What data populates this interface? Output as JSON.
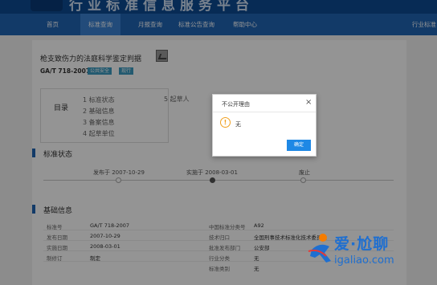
{
  "header": {
    "site_title": "行业标准信息服务平台"
  },
  "nav": {
    "items": [
      {
        "label": "首页"
      },
      {
        "label": "标准查询"
      },
      {
        "label": "月报查询"
      },
      {
        "label": "标准公告查询"
      },
      {
        "label": "帮助中心"
      },
      {
        "label": "行业标准"
      }
    ]
  },
  "document": {
    "title": "枪支致伤力的法庭科学鉴定判据",
    "code": "GA/T 718-2007",
    "tags": [
      "公共安全",
      "现行"
    ]
  },
  "toc": {
    "label": "目录",
    "items": [
      "1 标准状态",
      "2 基础信息",
      "3 备案信息",
      "4 起草单位",
      "5 起草人"
    ]
  },
  "status_section": {
    "title": "标准状态",
    "timeline": [
      {
        "label": "发布于 2007-10-29"
      },
      {
        "label": "实施于 2008-03-01"
      },
      {
        "label": "废止"
      }
    ]
  },
  "basic_info": {
    "title": "基础信息",
    "left": [
      {
        "label": "标准号",
        "value": "GA/T 718-2007"
      },
      {
        "label": "发布日期",
        "value": "2007-10-29"
      },
      {
        "label": "实施日期",
        "value": "2008-03-01"
      },
      {
        "label": "制修订",
        "value": "制定"
      }
    ],
    "right": [
      {
        "label": "中国标准分类号",
        "value": "A92"
      },
      {
        "label": "技术归口",
        "value": "全国刑事技术标准化技术委员会"
      },
      {
        "label": "批准发布部门",
        "value": "公安部"
      },
      {
        "label": "行业分类",
        "value": "无"
      },
      {
        "label": "标准类别",
        "value": "无"
      }
    ]
  },
  "modal": {
    "title": "不公开理由",
    "close_glyph": "×",
    "message": "无",
    "ok_label": "确定"
  },
  "watermark": {
    "text": "爱·尬聊",
    "url": "igaliao.com"
  },
  "colors": {
    "header_bg": "#0d4a93",
    "nav_bg": "#1f64b4",
    "nav_active": "#3b82d2",
    "tag_bg": "#3d9cc2",
    "ok_button": "#1e88e5",
    "warn": "#f0a020"
  },
  "icons": {
    "pdf": "pdf-icon",
    "warning": "warning-icon",
    "close": "close-icon"
  }
}
